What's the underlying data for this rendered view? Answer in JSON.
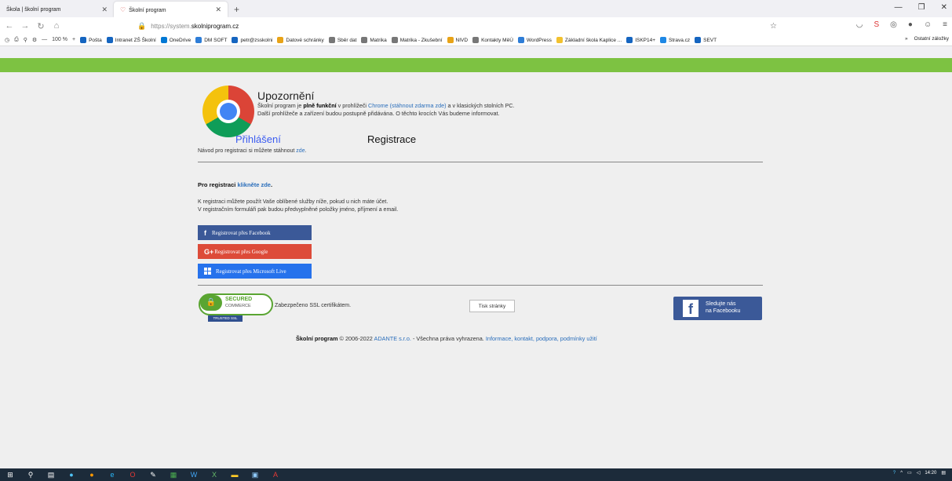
{
  "browser": {
    "tabs": [
      {
        "title": "Škola | školní program",
        "active": false
      },
      {
        "title": "Školní program",
        "active": true
      }
    ],
    "new_tab": "+",
    "url_prefix": "https://system.",
    "url_domain": "skolniprogram.cz",
    "zoom": "100 %",
    "bookmarks": [
      {
        "label": "Pošta",
        "color": "#1565c0"
      },
      {
        "label": "Intranet ZŠ Školní",
        "color": "#1565c0"
      },
      {
        "label": "OneDrive",
        "color": "#0078d4"
      },
      {
        "label": "DM SOFT",
        "color": "#2e7dd7"
      },
      {
        "label": "petr@zsskolni",
        "color": "#1565c0"
      },
      {
        "label": "Datové schránky",
        "color": "#e8a317"
      },
      {
        "label": "Sběr dat",
        "color": "#777"
      },
      {
        "label": "Matrika",
        "color": "#777"
      },
      {
        "label": "Matrika - Zkušební",
        "color": "#777"
      },
      {
        "label": "NIVD",
        "color": "#e8a317"
      },
      {
        "label": "Kontakty MěÚ",
        "color": "#777"
      },
      {
        "label": "WordPress",
        "color": "#2e7dd7"
      },
      {
        "label": "Základní škola Kaplice ...",
        "color": "#f2c12e"
      },
      {
        "label": "ISKP14+",
        "color": "#1565c0"
      },
      {
        "label": "Strava.cz",
        "color": "#1e88e5"
      },
      {
        "label": "SEVT",
        "color": "#1565c0"
      }
    ],
    "other_bookmarks": "Ostatní záložky"
  },
  "page": {
    "warning_title": "Upozornění",
    "warning_line1_pre": "Školní program je ",
    "warning_line1_bold": "plně funkční",
    "warning_line1_mid": " v prohlížeči ",
    "warning_line1_link": "Chrome (stáhnout zdarma zde)",
    "warning_line1_post": " a v klasických stolních PC.",
    "warning_line2": "Další prohlížeče a zařízení budou postupně přidávána. O těchto krocích Vás budeme informovat.",
    "tab_login": "Přihlášení",
    "tab_register": "Registrace",
    "guide_text": "Návod pro registraci si můžete stáhnout ",
    "guide_link": "zde",
    "guide_end": ".",
    "reg_title": "Pro registraci ",
    "reg_link": "klikněte zde",
    "reg_end": ".",
    "reg_text1": "K registraci můžete použít Vaše oblíbené služby níže, pokud u nich máte účet.",
    "reg_text2": "V registračním formuláři pak budou předvyplněné položky jméno, příjmení a email.",
    "btn_facebook": "Registrovat přes Facebook",
    "btn_google": "Registrovat přes Google",
    "btn_microsoft": "Registrovat přes Microsoft Live",
    "ssl_secured": "SECURED",
    "ssl_commerce": "COMMERCE",
    "ssl_trusted": "TRUSTED SSL",
    "ssl_text": "Zabezpečeno SSL certifikátem.",
    "print_btn": "Tisk stránky",
    "fb_follow_line1": "Sledujte nás",
    "fb_follow_line2": "na Facebooku",
    "footer_bold": "Školní program",
    "footer_copy": " © 2006-2022 ",
    "footer_company": "ADANTE s.r.o.",
    "footer_rights": " - Všechna práva vyhrazena. ",
    "footer_links": "Informace, kontakt, podpora, podmínky užití"
  },
  "taskbar": {
    "time": "14:20"
  },
  "colors": {
    "green_bar": "#7dc242",
    "facebook": "#3b5998",
    "google": "#dd4b39",
    "microsoft": "#2672ec",
    "link": "#2a6ebb"
  }
}
